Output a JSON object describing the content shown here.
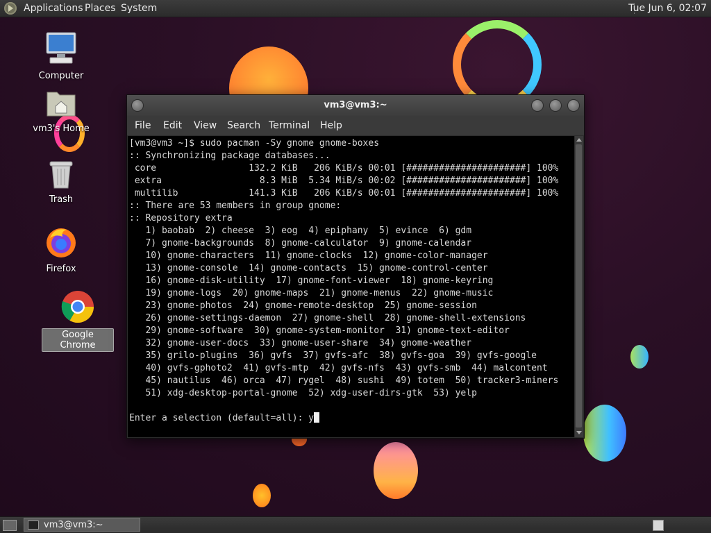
{
  "top_panel": {
    "menus": [
      "Applications",
      "Places",
      "System"
    ],
    "clock": "Tue Jun  6, 02:07"
  },
  "desktop_icons": [
    {
      "label": "Computer",
      "icon": "computer-icon"
    },
    {
      "label": "vm3's Home",
      "icon": "home-folder-icon"
    },
    {
      "label": "Trash",
      "icon": "trash-icon"
    },
    {
      "label": "Firefox",
      "icon": "firefox-icon"
    },
    {
      "label": "Google Chrome",
      "icon": "chrome-icon",
      "selected": true
    }
  ],
  "terminal": {
    "title": "vm3@vm3:~",
    "menu": [
      "File",
      "Edit",
      "View",
      "Search",
      "Terminal",
      "Help"
    ],
    "lines": [
      "[vm3@vm3 ~]$ sudo pacman -Sy gnome gnome-boxes",
      ":: Synchronizing package databases...",
      " core                 132.2 KiB   206 KiB/s 00:01 [######################] 100%",
      " extra                  8.3 MiB  5.34 MiB/s 00:02 [######################] 100%",
      " multilib             141.3 KiB   206 KiB/s 00:01 [######################] 100%",
      ":: There are 53 members in group gnome:",
      ":: Repository extra",
      "   1) baobab  2) cheese  3) eog  4) epiphany  5) evince  6) gdm",
      "   7) gnome-backgrounds  8) gnome-calculator  9) gnome-calendar",
      "   10) gnome-characters  11) gnome-clocks  12) gnome-color-manager",
      "   13) gnome-console  14) gnome-contacts  15) gnome-control-center",
      "   16) gnome-disk-utility  17) gnome-font-viewer  18) gnome-keyring",
      "   19) gnome-logs  20) gnome-maps  21) gnome-menus  22) gnome-music",
      "   23) gnome-photos  24) gnome-remote-desktop  25) gnome-session",
      "   26) gnome-settings-daemon  27) gnome-shell  28) gnome-shell-extensions",
      "   29) gnome-software  30) gnome-system-monitor  31) gnome-text-editor",
      "   32) gnome-user-docs  33) gnome-user-share  34) gnome-weather",
      "   35) grilo-plugins  36) gvfs  37) gvfs-afc  38) gvfs-goa  39) gvfs-google",
      "   40) gvfs-gphoto2  41) gvfs-mtp  42) gvfs-nfs  43) gvfs-smb  44) malcontent",
      "   45) nautilus  46) orca  47) rygel  48) sushi  49) totem  50) tracker3-miners",
      "   51) xdg-desktop-portal-gnome  52) xdg-user-dirs-gtk  53) yelp",
      ""
    ],
    "prompt": "Enter a selection (default=all): ",
    "input": "y"
  },
  "taskbar": {
    "tasks": [
      {
        "label": "vm3@vm3:~",
        "icon": "terminal-icon"
      }
    ]
  }
}
